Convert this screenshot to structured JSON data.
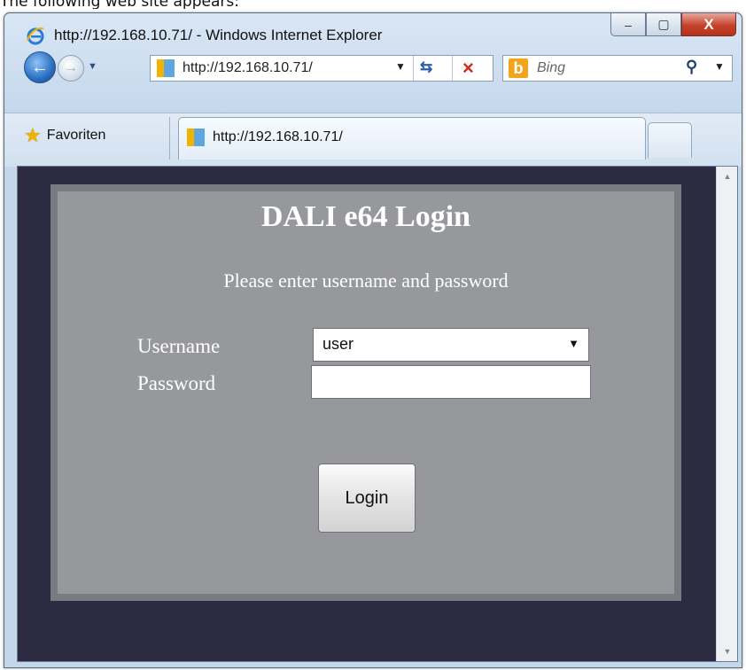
{
  "document": {
    "caption": "The following web site appears:"
  },
  "window": {
    "title": "http://192.168.10.71/ - Windows Internet Explorer",
    "controls": {
      "minimize": "‒",
      "maximize": "▢",
      "close": "X"
    }
  },
  "navigation": {
    "back_glyph": "←",
    "forward_glyph": "→",
    "history_dropdown_glyph": "▼",
    "address": "http://192.168.10.71/",
    "address_dropdown_glyph": "▼",
    "refresh_glyph": "⇆",
    "stop_glyph": "×"
  },
  "search": {
    "provider_logo": "b",
    "placeholder": "Bing",
    "search_glyph": "⚲",
    "dropdown_glyph": "▼"
  },
  "tabs": {
    "favorites_label": "Favoriten",
    "items": [
      {
        "label": "http://192.168.10.71/"
      }
    ]
  },
  "login": {
    "title": "DALI e64 Login",
    "subtitle": "Please enter username and password",
    "username_label": "Username",
    "username_value": "user",
    "username_options": [
      "user"
    ],
    "password_label": "Password",
    "password_value": "",
    "button_label": "Login"
  },
  "scrollbar": {
    "up_glyph": "▲",
    "down_glyph": "▼"
  },
  "colors": {
    "page_background": "#2d2b42",
    "panel_background": "#97989c",
    "panel_border": "#7a7b80",
    "close_button": "#c4412a"
  }
}
